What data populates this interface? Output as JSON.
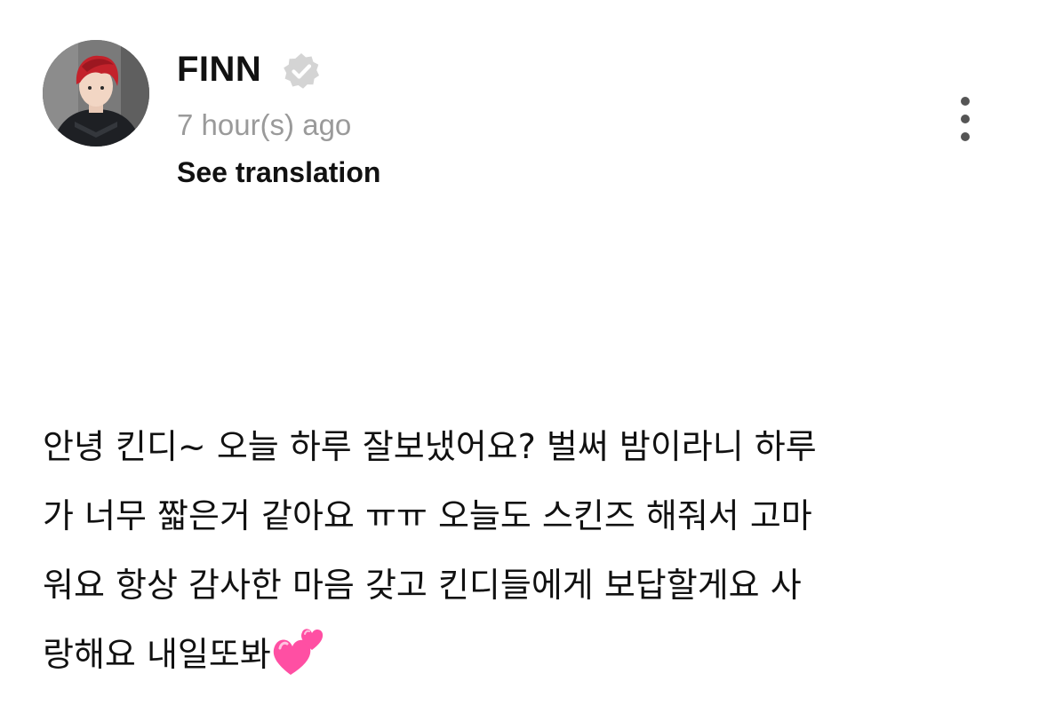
{
  "post": {
    "author": {
      "name": "FINN",
      "verified": true,
      "avatar_icon": "avatar-illustrated-red-hair"
    },
    "timestamp": "7 hour(s) ago",
    "see_translation_label": "See translation",
    "more_menu_icon": "vertical-ellipsis-icon",
    "body_lines": [
      "안녕 킨디~ 오늘 하루 잘보냈어요? 벌써 밤이라니 하루",
      "가 너무 짧은거 같아요 ㅠㅠ 오늘도 스킨즈 해줘서 고마",
      "워요 항상 감사한 마음 갖고 킨디들에게 보답할게요 사",
      "랑해요 내일또봐"
    ],
    "body_emoji": "two-hearts-icon",
    "colors": {
      "text": "#111111",
      "timestamp": "#9a9a9a",
      "verified_badge": "#d4d4d4",
      "heart_pink": "#ff4fa3"
    }
  }
}
